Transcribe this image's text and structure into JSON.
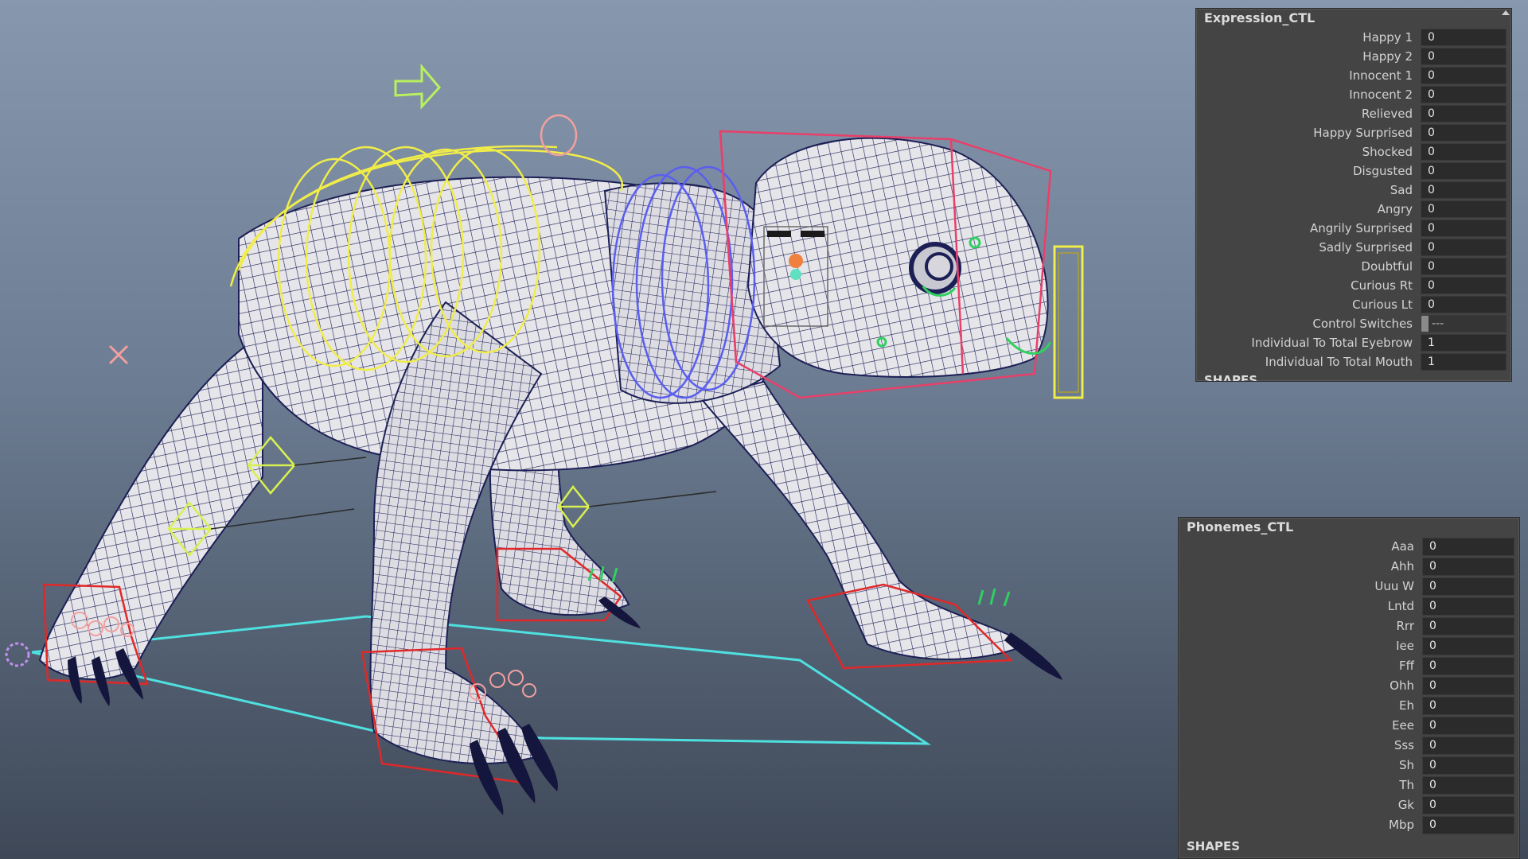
{
  "panels": {
    "expression": {
      "title": "Expression_CTL",
      "attributes": [
        {
          "label": "Happy 1",
          "value": "0"
        },
        {
          "label": "Happy 2",
          "value": "0"
        },
        {
          "label": "Innocent 1",
          "value": "0"
        },
        {
          "label": "Innocent 2",
          "value": "0"
        },
        {
          "label": "Relieved",
          "value": "0"
        },
        {
          "label": "Happy Surprised",
          "value": "0"
        },
        {
          "label": "Shocked",
          "value": "0"
        },
        {
          "label": "Disgusted",
          "value": "0"
        },
        {
          "label": "Sad",
          "value": "0"
        },
        {
          "label": "Angry",
          "value": "0"
        },
        {
          "label": "Angrily Surprised",
          "value": "0"
        },
        {
          "label": "Sadly Surprised",
          "value": "0"
        },
        {
          "label": "Doubtful",
          "value": "0"
        },
        {
          "label": "Curious Rt",
          "value": "0"
        },
        {
          "label": "Curious Lt",
          "value": "0"
        },
        {
          "label": "Control Switches",
          "value": "---"
        },
        {
          "label": "Individual To Total Eyebrow",
          "value": "1"
        },
        {
          "label": "Individual To Total Mouth",
          "value": "1"
        }
      ],
      "shapes_label": "SHAPES"
    },
    "phonemes": {
      "title": "Phonemes_CTL",
      "attributes": [
        {
          "label": "Aaa",
          "value": "0"
        },
        {
          "label": "Ahh",
          "value": "0"
        },
        {
          "label": "Uuu W",
          "value": "0"
        },
        {
          "label": "Lntd",
          "value": "0"
        },
        {
          "label": "Rrr",
          "value": "0"
        },
        {
          "label": "Iee",
          "value": "0"
        },
        {
          "label": "Fff",
          "value": "0"
        },
        {
          "label": "Ohh",
          "value": "0"
        },
        {
          "label": "Eh",
          "value": "0"
        },
        {
          "label": "Eee",
          "value": "0"
        },
        {
          "label": "Sss",
          "value": "0"
        },
        {
          "label": "Sh",
          "value": "0"
        },
        {
          "label": "Th",
          "value": "0"
        },
        {
          "label": "Gk",
          "value": "0"
        },
        {
          "label": "Mbp",
          "value": "0"
        }
      ],
      "shapes_label": "SHAPES"
    }
  },
  "colors": {
    "mesh_fill": "#e6e6ea",
    "wire": "#1c1f55",
    "spine_ctrl": "#f0ec4a",
    "neck_ctrl": "#5a5ef0",
    "head_box": "#e8406a",
    "foot_ctrl": "#e02828",
    "ground_ctrl": "#4fe0e0",
    "move_arrow": "#b8f060",
    "pole_vector": "#d8f050"
  },
  "icons": [
    "move-arrow-icon",
    "cog-control-icon",
    "cross-control-icon"
  ]
}
